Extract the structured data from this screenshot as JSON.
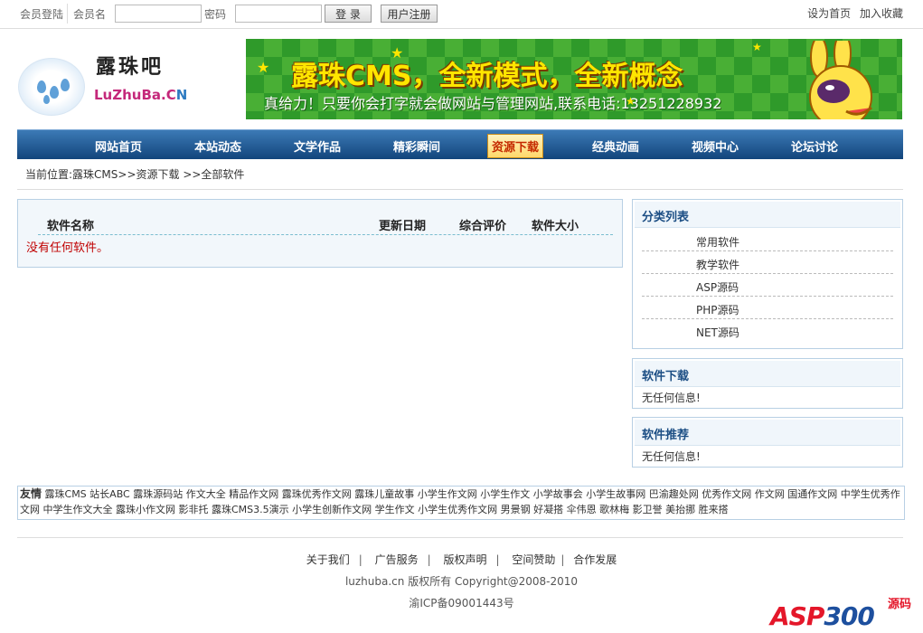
{
  "topbar": {
    "login_title": "会员登陆",
    "username_label": "会员名",
    "username_value": "",
    "password_label": "密码",
    "password_value": "",
    "login_button": "登 录",
    "register_button": "用户注册",
    "set_home": "设为首页",
    "add_favorite": "加入收藏"
  },
  "logo": {
    "name_cn": "露珠吧",
    "name_en_main": "LuZhuBa.C",
    "name_en_tail": "N"
  },
  "banner": {
    "headline": "露珠CMS，全新模式，全新概念",
    "subline": "真给力！只要你会打字就会做网站与管理网站,联系电话:13251228932"
  },
  "nav": {
    "items": [
      "网站首页",
      "本站动态",
      "文学作品",
      "精彩瞬间",
      "资源下载",
      "经典动画",
      "视频中心",
      "论坛讨论"
    ],
    "active_index": 4
  },
  "breadcrumb": "当前位置:露珠CMS>>资源下载 >>全部软件",
  "software_list": {
    "columns": [
      "软件名称",
      "更新日期",
      "综合评价",
      "软件大小"
    ],
    "empty_message": "没有任何软件。"
  },
  "sidebar": {
    "categories": {
      "title": "分类列表",
      "items": [
        "常用软件",
        "教学软件",
        "ASP源码",
        "PHP源码",
        "NET源码"
      ]
    },
    "downloads": {
      "title": "软件下载",
      "message": "无任何信息!"
    },
    "recommend": {
      "title": "软件推荐",
      "message": "无任何信息!"
    }
  },
  "friend_links": {
    "label": "友情",
    "items": [
      "露珠CMS",
      "站长ABC",
      "露珠源码站",
      "作文大全",
      "精品作文网",
      "露珠优秀作文网",
      "露珠儿童故事",
      "小学生作文网",
      "小学生作文",
      "小学故事会",
      "小学生故事网",
      "巴渝趣处网",
      "优秀作文网",
      "作文网",
      "国通作文网",
      "中学生优秀作文网",
      "中学生作文大全",
      "露珠小作文网",
      "影非托",
      "露珠CMS3.5演示",
      "小学生创新作文网",
      "学生作文",
      "小学生优秀作文网",
      "男景钢",
      "好凝搭",
      "伞伟恩",
      "歌林梅",
      "影卫誉",
      "美抬挪",
      "胜来搭"
    ]
  },
  "footer": {
    "links": [
      "关于我们",
      "广告服务",
      "版权声明",
      "空间赞助",
      "合作发展"
    ],
    "copyright": "luzhuba.cn 版权所有 Copyright@2008-2010",
    "icp": "渝ICP备09001443号"
  },
  "watermark": {
    "text_red": "ASP",
    "text_blue": "300",
    "suffix": "源码"
  },
  "colors": {
    "nav_top": "#3c7ab6",
    "nav_bottom": "#12457c",
    "accent_red": "#c00000",
    "border_blue": "#b8d0e4"
  }
}
